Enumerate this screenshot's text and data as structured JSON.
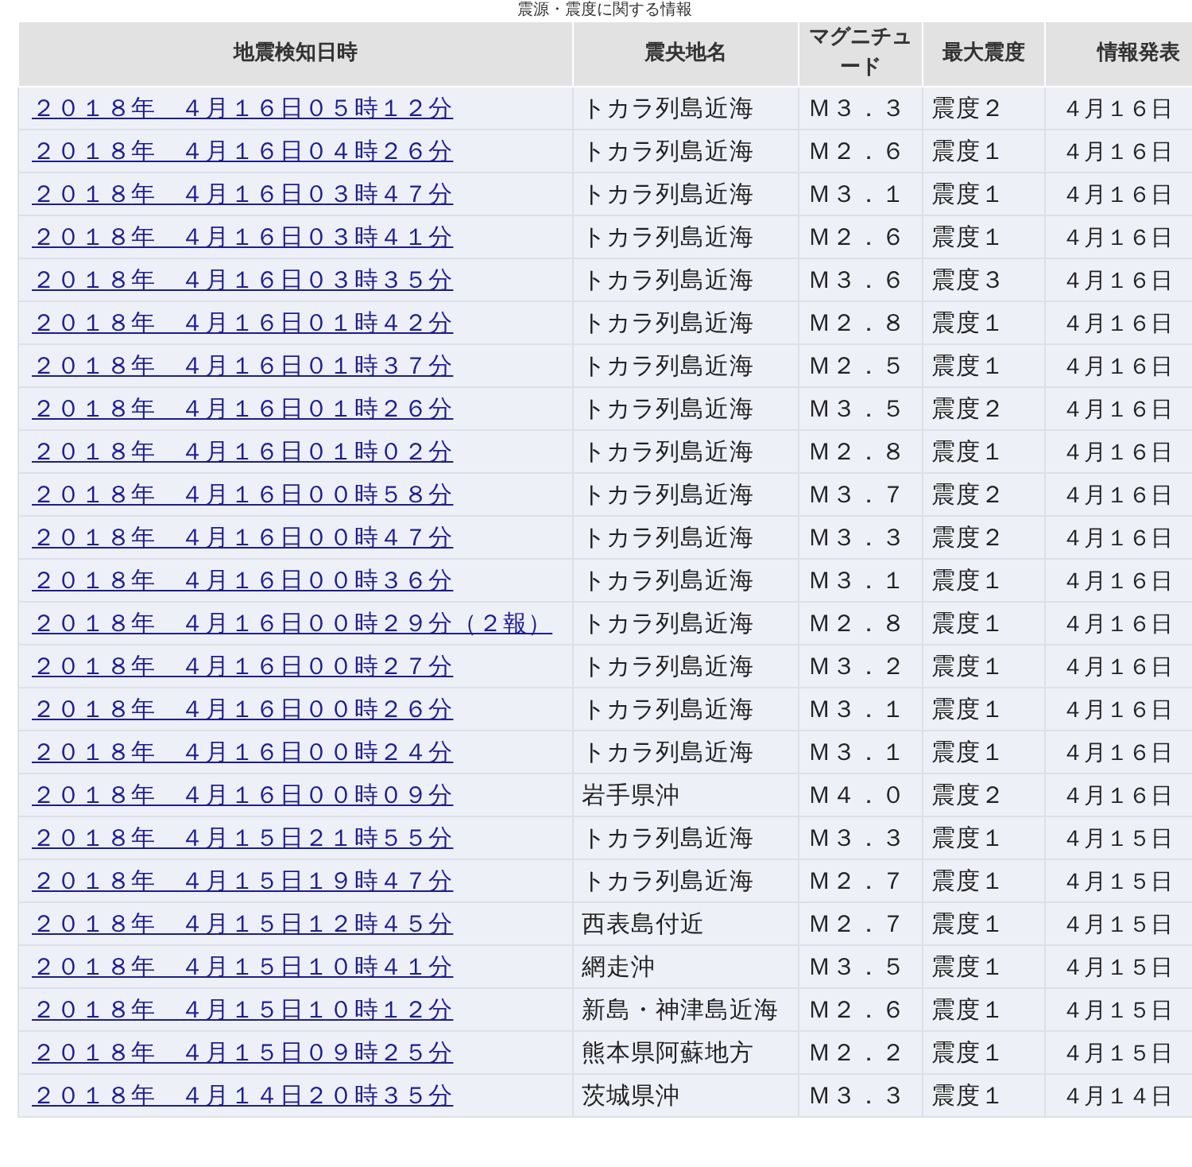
{
  "caption": "震源・震度に関する情報",
  "table": {
    "columns": [
      "地震検知日時",
      "震央地名",
      "マグニチュード",
      "最大震度",
      "情報発表"
    ],
    "rows": [
      {
        "time": "２０１８年　４月１６日０５時１２分",
        "place": "トカラ列島近海",
        "magnitude": "Ｍ３．３",
        "intensity": "震度２",
        "issued": "４月１６日"
      },
      {
        "time": "２０１８年　４月１６日０４時２６分",
        "place": "トカラ列島近海",
        "magnitude": "Ｍ２．６",
        "intensity": "震度１",
        "issued": "４月１６日"
      },
      {
        "time": "２０１８年　４月１６日０３時４７分",
        "place": "トカラ列島近海",
        "magnitude": "Ｍ３．１",
        "intensity": "震度１",
        "issued": "４月１６日"
      },
      {
        "time": "２０１８年　４月１６日０３時４１分",
        "place": "トカラ列島近海",
        "magnitude": "Ｍ２．６",
        "intensity": "震度１",
        "issued": "４月１６日"
      },
      {
        "time": "２０１８年　４月１６日０３時３５分",
        "place": "トカラ列島近海",
        "magnitude": "Ｍ３．６",
        "intensity": "震度３",
        "issued": "４月１６日"
      },
      {
        "time": "２０１８年　４月１６日０１時４２分",
        "place": "トカラ列島近海",
        "magnitude": "Ｍ２．８",
        "intensity": "震度１",
        "issued": "４月１６日"
      },
      {
        "time": "２０１８年　４月１６日０１時３７分",
        "place": "トカラ列島近海",
        "magnitude": "Ｍ２．５",
        "intensity": "震度１",
        "issued": "４月１６日"
      },
      {
        "time": "２０１８年　４月１６日０１時２６分",
        "place": "トカラ列島近海",
        "magnitude": "Ｍ３．５",
        "intensity": "震度２",
        "issued": "４月１６日"
      },
      {
        "time": "２０１８年　４月１６日０１時０２分",
        "place": "トカラ列島近海",
        "magnitude": "Ｍ２．８",
        "intensity": "震度１",
        "issued": "４月１６日"
      },
      {
        "time": "２０１８年　４月１６日００時５８分",
        "place": "トカラ列島近海",
        "magnitude": "Ｍ３．７",
        "intensity": "震度２",
        "issued": "４月１６日"
      },
      {
        "time": "２０１８年　４月１６日００時４７分",
        "place": "トカラ列島近海",
        "magnitude": "Ｍ３．３",
        "intensity": "震度２",
        "issued": "４月１６日"
      },
      {
        "time": "２０１８年　４月１６日００時３６分",
        "place": "トカラ列島近海",
        "magnitude": "Ｍ３．１",
        "intensity": "震度１",
        "issued": "４月１６日"
      },
      {
        "time": "２０１８年　４月１６日００時２９分（２報）",
        "place": "トカラ列島近海",
        "magnitude": "Ｍ２．８",
        "intensity": "震度１",
        "issued": "４月１６日"
      },
      {
        "time": "２０１８年　４月１６日００時２７分",
        "place": "トカラ列島近海",
        "magnitude": "Ｍ３．２",
        "intensity": "震度１",
        "issued": "４月１６日"
      },
      {
        "time": "２０１８年　４月１６日００時２６分",
        "place": "トカラ列島近海",
        "magnitude": "Ｍ３．１",
        "intensity": "震度１",
        "issued": "４月１６日"
      },
      {
        "time": "２０１８年　４月１６日００時２４分",
        "place": "トカラ列島近海",
        "magnitude": "Ｍ３．１",
        "intensity": "震度１",
        "issued": "４月１６日"
      },
      {
        "time": "２０１８年　４月１６日００時０９分",
        "place": "岩手県沖",
        "magnitude": "Ｍ４．０",
        "intensity": "震度２",
        "issued": "４月１６日"
      },
      {
        "time": "２０１８年　４月１５日２１時５５分",
        "place": "トカラ列島近海",
        "magnitude": "Ｍ３．３",
        "intensity": "震度１",
        "issued": "４月１５日"
      },
      {
        "time": "２０１８年　４月１５日１９時４７分",
        "place": "トカラ列島近海",
        "magnitude": "Ｍ２．７",
        "intensity": "震度１",
        "issued": "４月１５日"
      },
      {
        "time": "２０１８年　４月１５日１２時４５分",
        "place": "西表島付近",
        "magnitude": "Ｍ２．７",
        "intensity": "震度１",
        "issued": "４月１５日"
      },
      {
        "time": "２０１８年　４月１５日１０時４１分",
        "place": "網走沖",
        "magnitude": "Ｍ３．５",
        "intensity": "震度１",
        "issued": "４月１５日"
      },
      {
        "time": "２０１８年　４月１５日１０時１２分",
        "place": "新島・神津島近海",
        "magnitude": "Ｍ２．６",
        "intensity": "震度１",
        "issued": "４月１５日"
      },
      {
        "time": "２０１８年　４月１５日０９時２５分",
        "place": "熊本県阿蘇地方",
        "magnitude": "Ｍ２．２",
        "intensity": "震度１",
        "issued": "４月１５日"
      },
      {
        "time": "２０１８年　４月１４日２０時３５分",
        "place": "茨城県沖",
        "magnitude": "Ｍ３．３",
        "intensity": "震度１",
        "issued": "４月１４日"
      }
    ]
  }
}
